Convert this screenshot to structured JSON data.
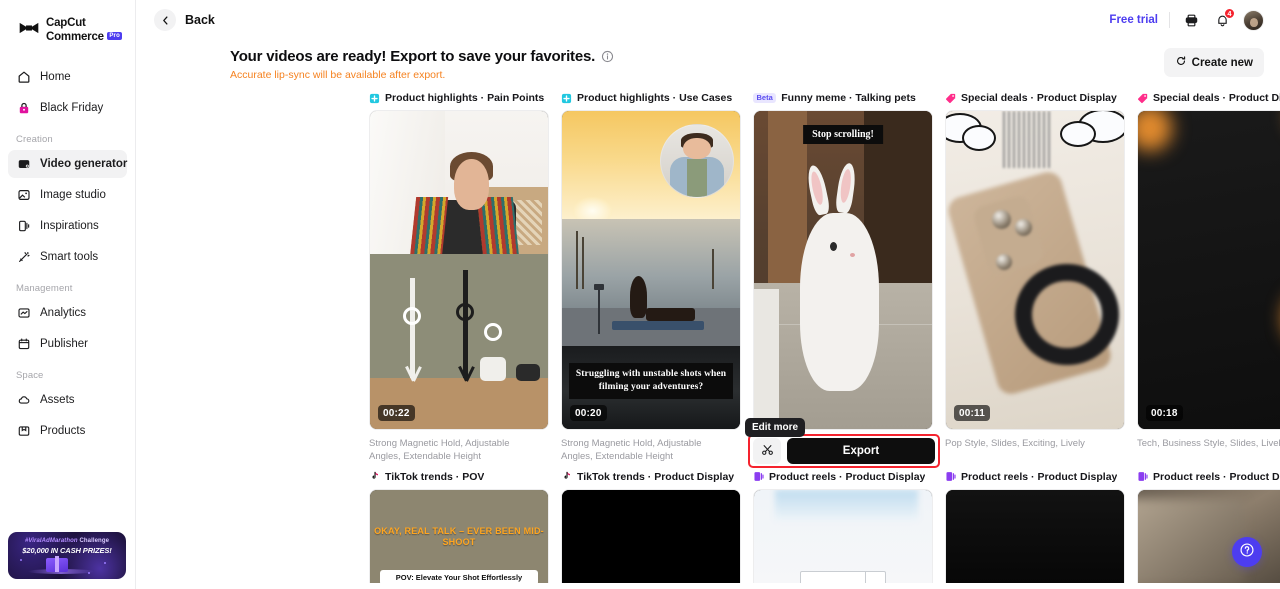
{
  "sidebar": {
    "logo": {
      "line1": "CapCut",
      "line2": "Commerce",
      "badge": "Pro"
    },
    "items": [
      {
        "label": "Home",
        "icon": "home-icon"
      },
      {
        "label": "Black Friday",
        "icon": "lock-icon"
      }
    ],
    "sections": [
      {
        "title": "Creation",
        "items": [
          {
            "label": "Video generator",
            "icon": "video-icon",
            "active": true
          },
          {
            "label": "Image studio",
            "icon": "image-icon",
            "active": false
          },
          {
            "label": "Inspirations",
            "icon": "inspiration-icon",
            "active": false
          },
          {
            "label": "Smart tools",
            "icon": "magic-wand-icon",
            "active": false
          }
        ]
      },
      {
        "title": "Management",
        "items": [
          {
            "label": "Analytics",
            "icon": "analytics-icon",
            "active": false
          },
          {
            "label": "Publisher",
            "icon": "calendar-icon",
            "active": false
          }
        ]
      },
      {
        "title": "Space",
        "items": [
          {
            "label": "Assets",
            "icon": "cloud-icon",
            "active": false
          },
          {
            "label": "Products",
            "icon": "box-icon",
            "active": false
          }
        ]
      }
    ],
    "promo": {
      "line1_tag": "#ViralAdMarathon",
      "line1_rest": " Challenge",
      "line2": "$20,000 IN CASH PRIZES!"
    }
  },
  "topbar": {
    "back_label": "Back",
    "free_trial_label": "Free trial",
    "notification_count": "4"
  },
  "header": {
    "title": "Your videos are ready! Export to save your favorites.",
    "subtitle": "Accurate lip-sync will be available after export.",
    "create_new_label": "Create new"
  },
  "overlay": {
    "tooltip_label": "Edit more",
    "export_label": "Export"
  },
  "cards_row1": [
    {
      "badge_type": "dot-cyan",
      "badge_text": "",
      "label": "Product highlights · Pain Points",
      "duration": "00:22",
      "description": "Strong Magnetic Hold, Adjustable Angles, Extendable Height",
      "overlay_text": ""
    },
    {
      "badge_type": "dot-cyan",
      "badge_text": "",
      "label": "Product highlights · Use Cases",
      "duration": "00:20",
      "description": "Strong Magnetic Hold, Adjustable Angles, Extendable Height",
      "overlay_text": "Struggling with unstable shots when filming your adventures?"
    },
    {
      "badge_type": "beta",
      "badge_text": "Beta",
      "label": "Funny meme · Talking pets",
      "duration": "",
      "description": "",
      "overlay_text": "Stop scrolling!"
    },
    {
      "badge_type": "tag-pink",
      "badge_text": "",
      "label": "Special deals · Product Display",
      "duration": "00:11",
      "description": "Pop Style, Slides, Exciting, Lively",
      "overlay_text": ""
    },
    {
      "badge_type": "tag-pink",
      "badge_text": "",
      "label": "Special deals · Product Display",
      "duration": "00:18",
      "description": "Tech, Business Style, Slides, Lively",
      "overlay_text": ""
    }
  ],
  "cards_row2": [
    {
      "badge_type": "tiktok",
      "label": "TikTok trends · POV",
      "overlay_text": "OKAY, REAL TALK – EVER BEEN MID-SHOOT",
      "caption": "POV: Elevate Your Shot Effortlessly"
    },
    {
      "badge_type": "tiktok",
      "label": "TikTok trends · Product Display",
      "overlay_text": "",
      "caption": ""
    },
    {
      "badge_type": "reel-purple",
      "label": "Product reels · Product Display",
      "overlay_text": "",
      "caption": ""
    },
    {
      "badge_type": "reel-purple",
      "label": "Product reels · Product Display",
      "overlay_text": "",
      "caption": ""
    },
    {
      "badge_type": "reel-purple",
      "label": "Product reels · Product Display",
      "overlay_text": "",
      "caption": ""
    }
  ],
  "colors": {
    "accent_purple": "#4d3df0",
    "warning_orange": "#f58220",
    "highlight_red": "#f5232e",
    "badge_cyan": "#22c8e0",
    "badge_pink": "#ff2d8a"
  }
}
